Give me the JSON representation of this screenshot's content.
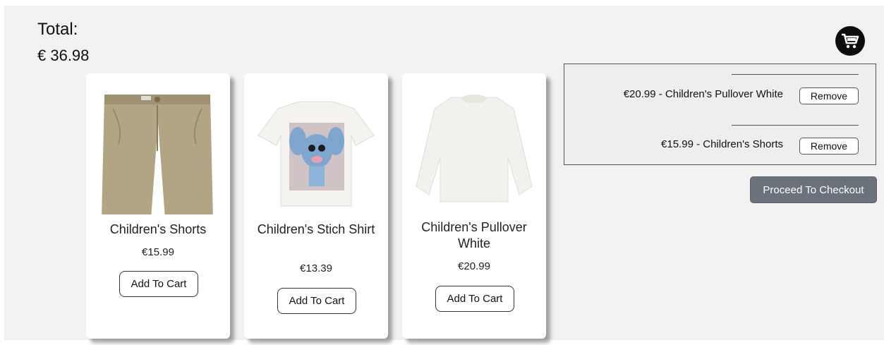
{
  "summary": {
    "total_label": "Total:",
    "total_value": "€ 36.98"
  },
  "header": {
    "cart_icon": "shopping-cart-icon"
  },
  "products": [
    {
      "title": "Children's Shorts",
      "price": "€15.99",
      "button": "Add To Cart",
      "image": "khaki-shorts-image"
    },
    {
      "title": "Children's Stich Shirt",
      "price": "€13.39",
      "button": "Add To Cart",
      "image": "stitch-tshirt-image"
    },
    {
      "title": "Children's Pullover White",
      "price": "€20.99",
      "button": "Add To Cart",
      "image": "white-pullover-image"
    }
  ],
  "cart": {
    "items": [
      {
        "text": "€20.99 - Children's Pullover White",
        "button": "Remove"
      },
      {
        "text": "€15.99 - Children's Shorts",
        "button": "Remove"
      }
    ],
    "checkout_label": "Proceed To Checkout"
  },
  "colors": {
    "checkout": "#6c727b",
    "background": "#f2f2f3",
    "card": "#ffffff"
  }
}
